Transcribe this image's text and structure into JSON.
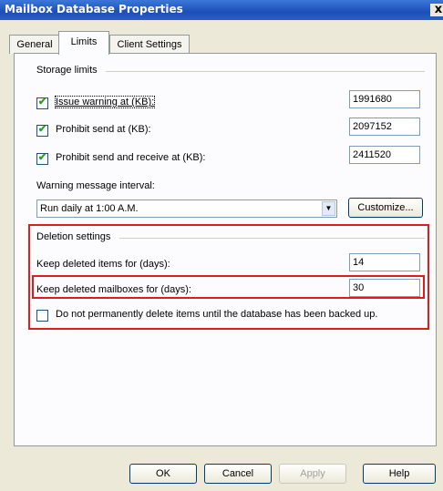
{
  "window": {
    "title": "Mailbox Database Properties",
    "close_glyph": "x"
  },
  "tabs": [
    {
      "label": "General",
      "active": false
    },
    {
      "label": "Limits",
      "active": true
    },
    {
      "label": "Client Settings",
      "active": false
    }
  ],
  "storage": {
    "group_label": "Storage limits",
    "issue_warning": {
      "label": "Issue warning at (KB):",
      "checked": true,
      "value": "1991680"
    },
    "prohibit_send": {
      "label": "Prohibit send at (KB):",
      "checked": true,
      "value": "2097152"
    },
    "prohibit_send_receive": {
      "label": "Prohibit send and receive at (KB):",
      "checked": true,
      "value": "2411520"
    },
    "warning_interval_label": "Warning message interval:",
    "warning_interval_value": "Run daily at 1:00 A.M.",
    "customize_label": "Customize..."
  },
  "deletion": {
    "group_label": "Deletion settings",
    "keep_items": {
      "label": "Keep deleted items for (days):",
      "value": "14"
    },
    "keep_mailboxes": {
      "label": "Keep deleted mailboxes for (days):",
      "value": "30"
    },
    "do_not_delete": {
      "label": "Do not permanently delete items until the database has been backed up.",
      "checked": false
    }
  },
  "buttons": {
    "ok": "OK",
    "cancel": "Cancel",
    "apply": "Apply",
    "help": "Help"
  },
  "colors": {
    "highlight": "#e01b1b",
    "titlebar": "#2a5fc8",
    "checkmark": "#21a121"
  },
  "icons": {
    "checkbox_check": "check-icon",
    "combo_arrow": "chevron-down-icon"
  }
}
